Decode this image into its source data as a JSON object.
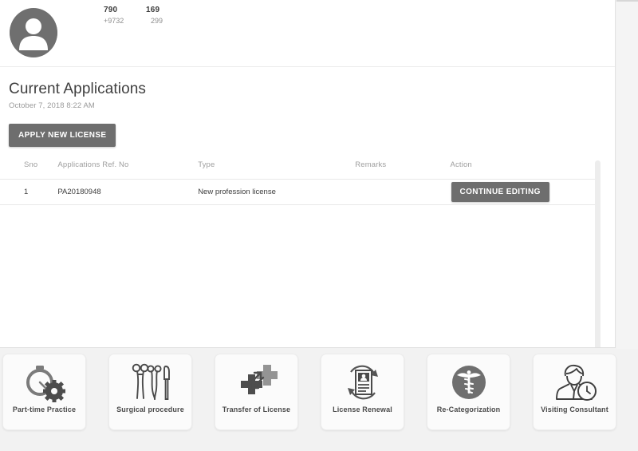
{
  "profile": {
    "avatar_icon": "user-avatar-icon",
    "stats": [
      {
        "value": "790",
        "sub": "+9732"
      },
      {
        "value": "169",
        "sub": "299"
      }
    ]
  },
  "applications": {
    "title": "Current Applications",
    "timestamp": "October 7, 2018 8:22 AM",
    "apply_button": "APPLY NEW LICENSE",
    "columns": [
      "Sno",
      "Applications Ref. No",
      "Type",
      "Remarks",
      "Action"
    ],
    "rows": [
      {
        "sno": "1",
        "ref_no": "PA20180948",
        "type": "New profession license",
        "remarks": "",
        "action": "CONTINUE EDITING"
      }
    ]
  },
  "services": [
    {
      "label": "Part-time Practice",
      "icon": "stopwatch-gear-icon"
    },
    {
      "label": "Surgical procedure",
      "icon": "surgical-instruments-icon"
    },
    {
      "label": "Transfer of License",
      "icon": "transfer-cross-arrows-icon"
    },
    {
      "label": "License Renewal",
      "icon": "id-card-renew-icon"
    },
    {
      "label": "Re-Categorization",
      "icon": "caduceus-icon"
    },
    {
      "label": "Visiting Consultant",
      "icon": "consultant-clock-icon"
    }
  ],
  "colors": {
    "accent_gray": "#6e6e6e",
    "panel_bg": "#ffffff",
    "page_bg": "#f2f2f2",
    "text_primary": "#3c3c3c",
    "text_muted": "#9e9e9e"
  }
}
